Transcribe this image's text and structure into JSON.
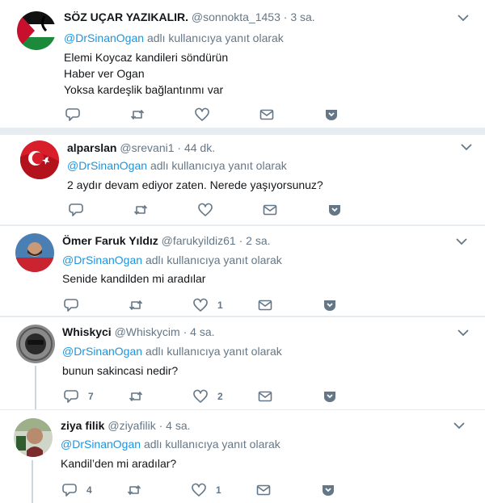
{
  "reply_prefix_suffix": "adlı kullanıcıya yanıt olarak",
  "tweets": [
    {
      "name": "SÖZ UÇAR YAZIKALIR.",
      "handle": "@sonnokta_1453",
      "dot": "·",
      "time": "3 sa.",
      "mention": "@DrSinanOgan",
      "reply_suffix": "adlı kullanıcıya yanıt olarak",
      "lines": [
        "Elemi Koycaz kandileri söndürün",
        "Haber ver Ogan",
        "Yoksa kardeşlik bağlantınmı var"
      ],
      "reply_count": "",
      "retweet_count": "",
      "like_count": ""
    },
    {
      "name": "alparslan",
      "handle": "@srevani1",
      "dot": "·",
      "time": "44 dk.",
      "mention": "@DrSinanOgan",
      "reply_suffix": "adlı kullanıcıya yanıt olarak",
      "lines": [
        "2 aydır devam ediyor zaten.  Nerede yaşıyorsunuz?"
      ],
      "reply_count": "",
      "retweet_count": "",
      "like_count": ""
    },
    {
      "name": "Ömer Faruk Yıldız",
      "handle": "@farukyildiz61",
      "dot": "·",
      "time": "2 sa.",
      "mention": "@DrSinanOgan",
      "reply_suffix": "adlı kullanıcıya yanıt olarak",
      "lines": [
        "Senide kandilden mi aradılar"
      ],
      "reply_count": "",
      "retweet_count": "",
      "like_count": "1"
    },
    {
      "name": "Whiskyci",
      "handle": "@Whiskycim",
      "dot": "·",
      "time": "4 sa.",
      "mention": "@DrSinanOgan",
      "reply_suffix": "adlı kullanıcıya yanıt olarak",
      "lines": [
        "bunun sakincasi nedir?"
      ],
      "reply_count": "7",
      "retweet_count": "",
      "like_count": "2"
    },
    {
      "name": "ziya filik",
      "handle": "@ziyafilik",
      "dot": "·",
      "time": "4 sa.",
      "mention": "@DrSinanOgan",
      "reply_suffix": "adlı kullanıcıya yanıt olarak",
      "lines": [
        "Kandil’den mi aradılar?"
      ],
      "reply_count": "4",
      "retweet_count": "",
      "like_count": "1"
    }
  ],
  "colors": {
    "link": "#1b95e0",
    "muted": "#657786",
    "icon": "#657786",
    "separator": "#e6ecf0",
    "thread_line": "#ccd6dd"
  },
  "icons": [
    "reply-icon",
    "retweet-icon",
    "like-icon",
    "direct-message-icon",
    "more-chevron-icon",
    "caret-down-icon"
  ]
}
